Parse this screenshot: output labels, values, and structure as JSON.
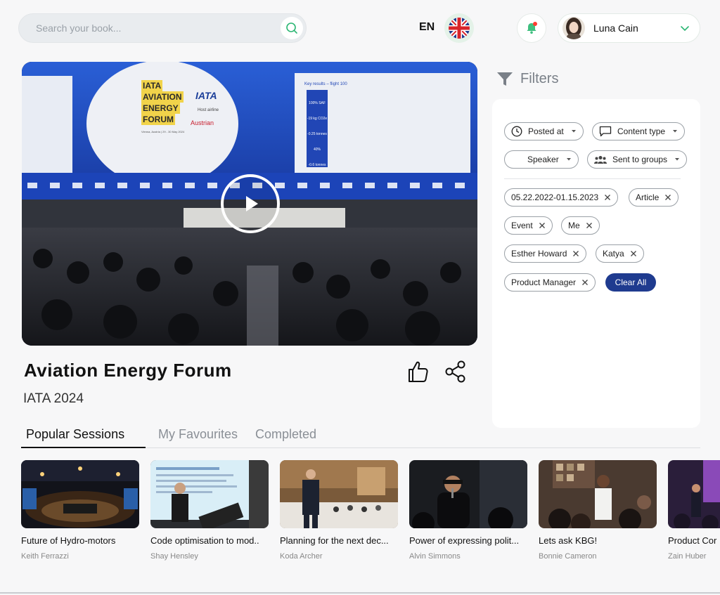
{
  "search": {
    "placeholder": "Search your book..."
  },
  "header": {
    "language": "EN",
    "user_name": "Luna Cain",
    "notification_color": "#ff3b30"
  },
  "video": {
    "title": "Aviation Energy Forum",
    "subtitle": "IATA 2024",
    "slide": {
      "line1": "IATA",
      "line2": "AVIATION",
      "line3": "ENERGY",
      "line4": "FORUM",
      "logo": "IATA",
      "host": "Host airline",
      "airline": "Austrian",
      "date": "Vienna, Austria | 29 - 30 May 2024",
      "right_header": "Key results – flight 100",
      "stats": [
        "100% SAF",
        "-19 kg CO2e",
        "-0.25 tonnes",
        "40%",
        "-0.6 tonnes"
      ]
    }
  },
  "filters": {
    "title": "Filters",
    "dropdowns": [
      "Posted at",
      "Content type",
      "Speaker",
      "Sent to groups"
    ],
    "active": [
      "05.22.2022-01.15.2023",
      "Article",
      "Event",
      "Me",
      "Esther Howard",
      "Katya",
      "Product Manager"
    ],
    "clear_label": "Clear All"
  },
  "tabs": [
    "Popular Sessions",
    "My Favourites",
    "Completed"
  ],
  "sessions": [
    {
      "title": "Future of Hydro-motors",
      "author": "Keith Ferrazzi"
    },
    {
      "title": "Code optimisation to mod..",
      "author": "Shay Hensley"
    },
    {
      "title": "Planning for the next dec...",
      "author": "Koda Archer"
    },
    {
      "title": "Power of expressing polit...",
      "author": "Alvin Simmons"
    },
    {
      "title": "Lets ask KBG!",
      "author": "Bonnie Cameron"
    },
    {
      "title": "Product Cor",
      "author": "Zain Huber"
    }
  ],
  "colors": {
    "accent": "#1f3b8f",
    "slide_gold": "#f1d34a",
    "stage_blue": "#2a5fd6"
  }
}
